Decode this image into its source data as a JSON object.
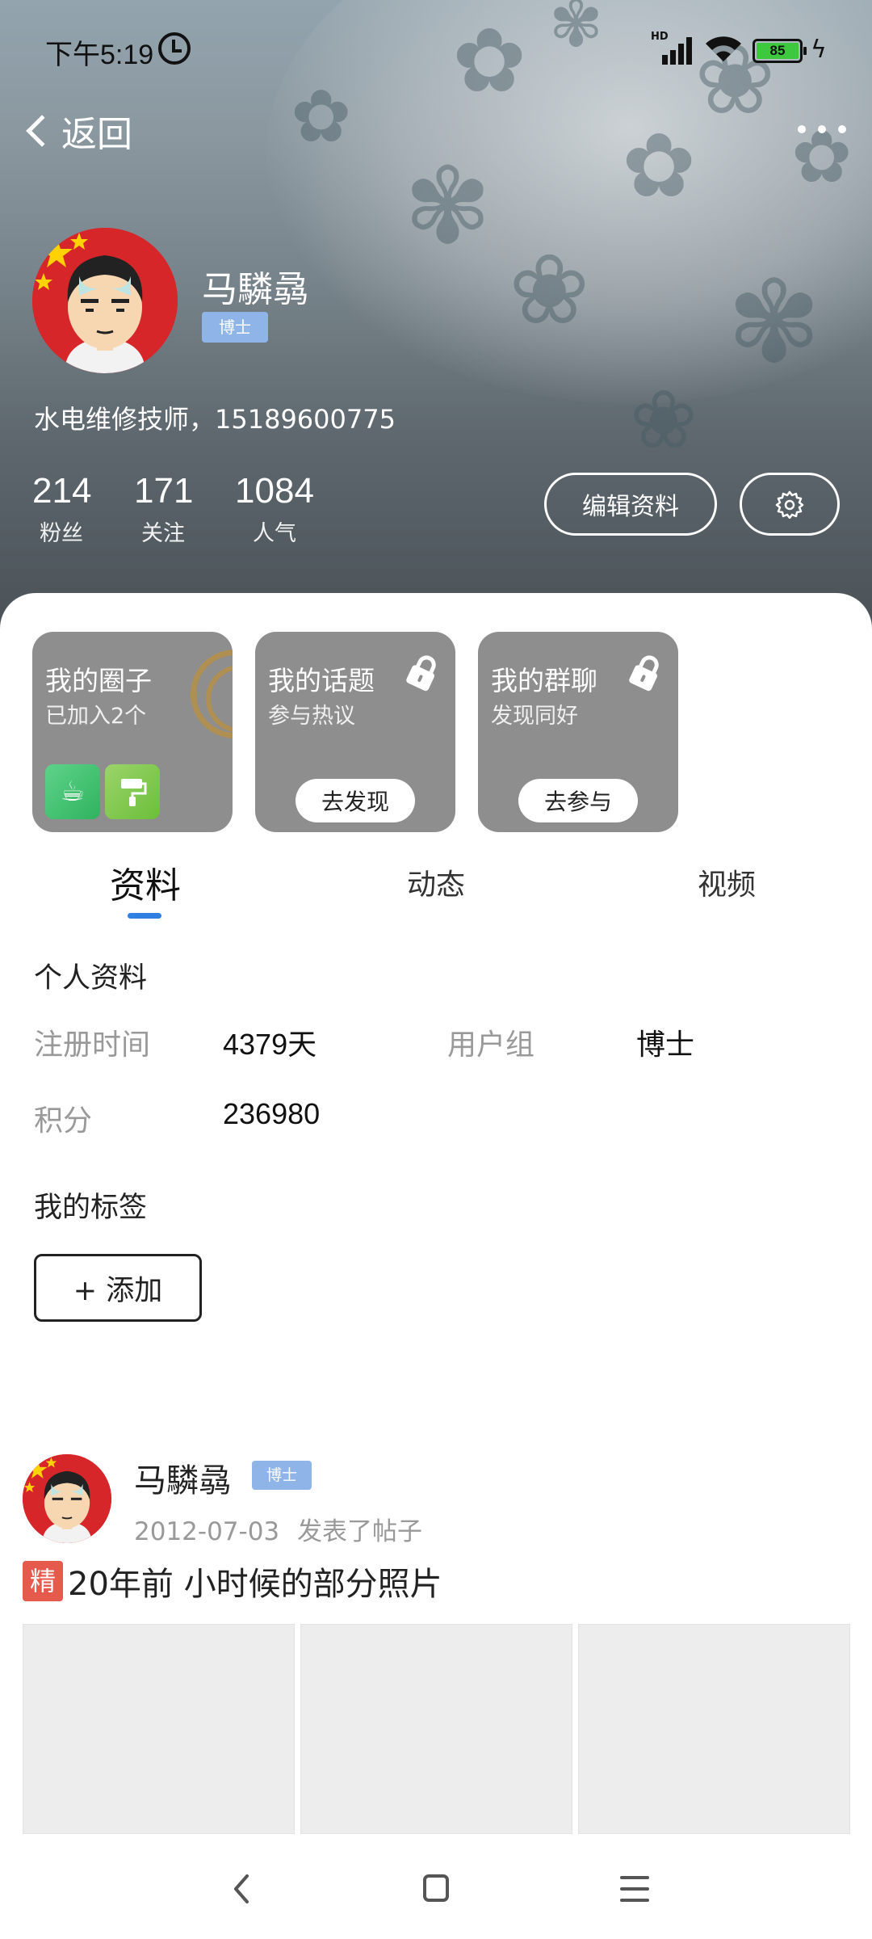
{
  "status_bar": {
    "time": "下午5:19",
    "network": "HD",
    "battery": "85"
  },
  "header": {
    "back_label": "返回",
    "more_icon": "more-dots-icon"
  },
  "profile": {
    "name": "马驎骉",
    "rank_badge": "博士",
    "bio": "水电维修技师，15189600775",
    "stats": [
      {
        "value": "214",
        "label": "粉丝"
      },
      {
        "value": "171",
        "label": "关注"
      },
      {
        "value": "1084",
        "label": "人气"
      }
    ],
    "edit_button": "编辑资料",
    "settings_icon": "gear-icon"
  },
  "cards": [
    {
      "title": "我的圈子",
      "subtitle": "已加入2个"
    },
    {
      "title": "我的话题",
      "subtitle": "参与热议",
      "action": "去发现"
    },
    {
      "title": "我的群聊",
      "subtitle": "发现同好",
      "action": "去参与"
    }
  ],
  "tabs": [
    {
      "label": "资料",
      "active": true
    },
    {
      "label": "动态",
      "active": false
    },
    {
      "label": "视频",
      "active": false
    }
  ],
  "info": {
    "section_title": "个人资料",
    "fields": [
      {
        "key": "注册时间",
        "value": "4379天"
      },
      {
        "key": "用户组",
        "value": "博士"
      },
      {
        "key": "积分",
        "value": "236980"
      }
    ],
    "tags_title": "我的标签",
    "add_button": "+ 添加"
  },
  "post": {
    "author": "马驎骉",
    "badge": "博士",
    "date": "2012-07-03",
    "action": "发表了帖子",
    "featured_label": "精",
    "title": "20年前 小时候的部分照片"
  },
  "colors": {
    "accent": "#2f80e0",
    "badge": "#8fb4e8",
    "featured": "#e65a4e",
    "card_bg": "#8e8e8e"
  }
}
